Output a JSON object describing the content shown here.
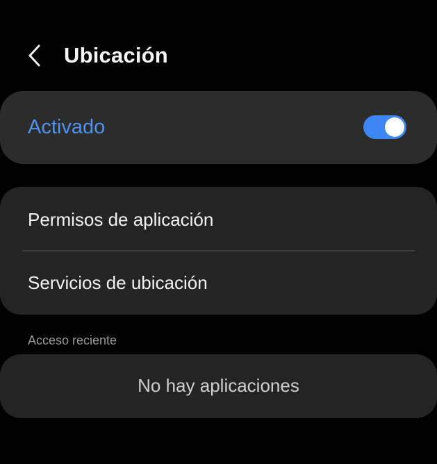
{
  "header": {
    "back_icon": "chevron-left-icon",
    "title": "Ubicación"
  },
  "master_switch": {
    "label": "Activado",
    "state": "on",
    "accent_color": "#4e92ee"
  },
  "settings_list": {
    "items": [
      {
        "label": "Permisos de aplicación"
      },
      {
        "label": "Servicios de ubicación"
      }
    ]
  },
  "recent_access": {
    "section_label": "Acceso reciente",
    "empty_message": "No hay aplicaciones"
  }
}
